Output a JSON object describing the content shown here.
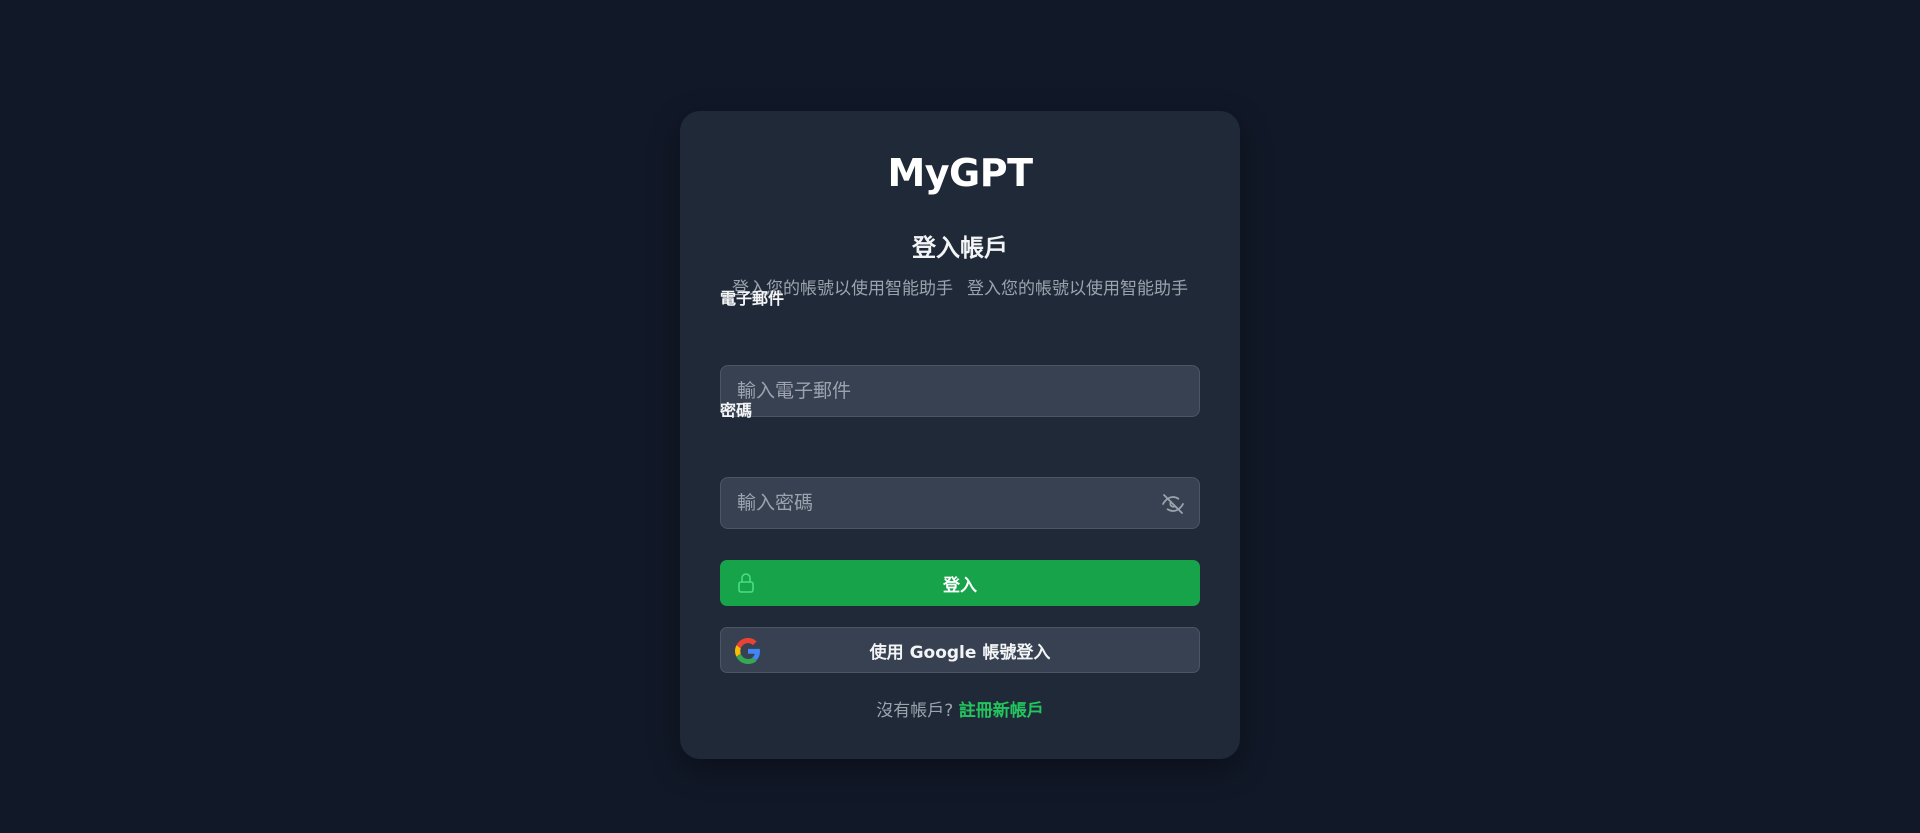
{
  "brand": "MyGPT",
  "heading": "登入帳戶",
  "subtitle": [
    "登入您的帳號以使用智能助手",
    "登入您的帳號以使用智能助手"
  ],
  "email": {
    "label": "電子郵件",
    "placeholder": "輸入電子郵件",
    "value": ""
  },
  "password": {
    "label": "密碼",
    "placeholder": "輸入密碼",
    "value": "",
    "toggle_icon": "eye-off-icon"
  },
  "login_button": {
    "label": "登入",
    "icon": "lock-icon"
  },
  "google_button": {
    "label": "使用 Google 帳號登入",
    "icon": "google-icon"
  },
  "footer": {
    "prompt": "沒有帳戶?",
    "link": "註冊新帳戶"
  },
  "colors": {
    "background": "#111827",
    "card": "#1f2937",
    "input": "#374151",
    "accent": "#16a34a",
    "link": "#22c55e"
  }
}
